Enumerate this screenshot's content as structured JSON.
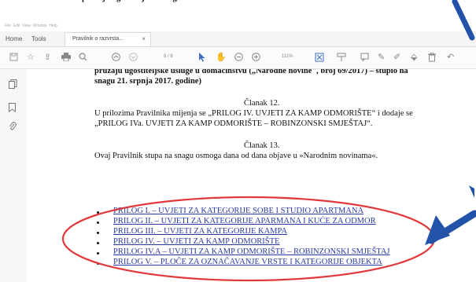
{
  "tabs": {
    "home": "Home",
    "tools": "Tools",
    "document": "Pravilnik o razvrsta...",
    "close": "×"
  },
  "toolbar": {
    "page_indicator": "8 / 8",
    "zoom": "111%"
  },
  "document": {
    "top_cut_line": "pružaju ugostiteljske usluge u domaćinstvu („Narodne novine“, broj  69/2017) – stupio na",
    "line1": "pružaju ugostiteljske usluge u domaćinstvu („Narodne novine\", broj  69/2017) – stupio na",
    "line2": "snagu 21. srpnja 2017. godine)",
    "article12_title": "Članak 12.",
    "article12_p1": "U prilozima Pravilnika mijenja se „PRILOG IV. UVJETI ZA KAMP ODMORIŠTE“ i dodaje se",
    "article12_p2": "„PRILOG IVa. UVJETI ZA KAMP ODMORIŠTE – ROBINZONSKI SMJEŠTAJ“.",
    "article13_title": "Članak 13.",
    "article13_p1": "Ovaj Pravilnik stupa na snagu osmoga dana od dana objave u »Narodnim novinama«.",
    "links": [
      "PRILOG I. – UVJETI ZA KATEGORIJE SOBE I STUDIO APARTMANA",
      "PRILOG II. – UVJETI ZA KATEGORIJE APARMANA I KUĆE ZA ODMOR",
      "PRILOG III. – UVJETI ZA KATEGORIJE KAMPA",
      "PRILOG IV. – UVJETI ZA KAMP ODMORIŠTE",
      "PRILOG IV.A – UVJETI ZA KAMP ODMORIŠTE – ROBINZONSKI SMJEŠTAJ",
      "PRILOG V. – PLOČE ZA OZNAČAVANJE VRSTE I KATEGORIJE OBJEKTA"
    ]
  },
  "colors": {
    "annotation": "#2253a8",
    "highlight_ellipse": "#e0393b",
    "link": "#2a3aa0"
  }
}
